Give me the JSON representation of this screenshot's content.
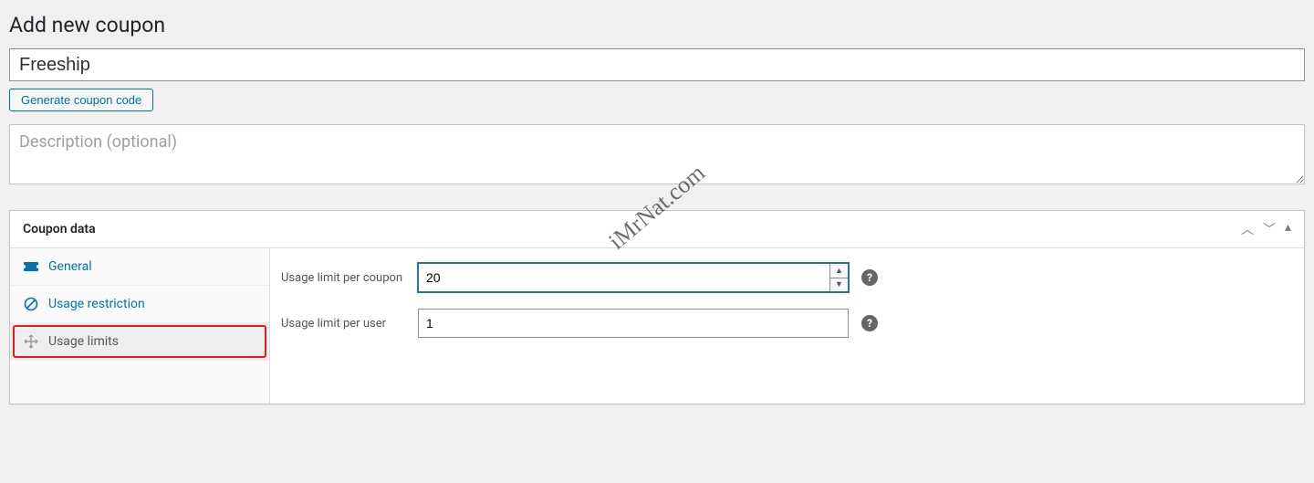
{
  "page": {
    "title": "Add new coupon"
  },
  "coupon": {
    "code": "Freeship",
    "generate_label": "Generate coupon code",
    "description_placeholder": "Description (optional)",
    "description_value": ""
  },
  "postbox": {
    "title": "Coupon data"
  },
  "tabs": {
    "general": {
      "label": "General"
    },
    "restriction": {
      "label": "Usage restriction"
    },
    "limits": {
      "label": "Usage limits"
    }
  },
  "form": {
    "usage_per_coupon": {
      "label": "Usage limit per coupon",
      "value": "20"
    },
    "usage_per_user": {
      "label": "Usage limit per user",
      "value": "1"
    }
  },
  "watermark": "iMrNat.com"
}
